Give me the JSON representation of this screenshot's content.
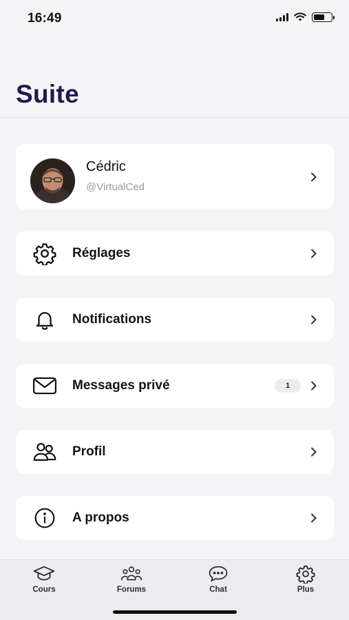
{
  "status": {
    "time": "16:49"
  },
  "page": {
    "title": "Suite"
  },
  "profile": {
    "name": "Cédric",
    "handle": "@VirtualCed"
  },
  "menu": [
    {
      "label": "Réglages",
      "icon": "gear-icon"
    },
    {
      "label": "Notifications",
      "icon": "bell-icon"
    },
    {
      "label": "Messages privé",
      "icon": "envelope-icon",
      "badge": "1"
    },
    {
      "label": "Profil",
      "icon": "users-icon"
    },
    {
      "label": "A propos",
      "icon": "info-icon"
    }
  ],
  "tabs": [
    {
      "label": "Cours",
      "icon": "graduation-cap-icon"
    },
    {
      "label": "Forums",
      "icon": "group-icon"
    },
    {
      "label": "Chat",
      "icon": "chat-bubble-icon"
    },
    {
      "label": "Plus",
      "icon": "gear-icon",
      "active": true
    }
  ],
  "colors": {
    "title": "#1e1a4a",
    "background": "#f4f4f6",
    "card": "#ffffff",
    "tabbar": "#ececef"
  }
}
